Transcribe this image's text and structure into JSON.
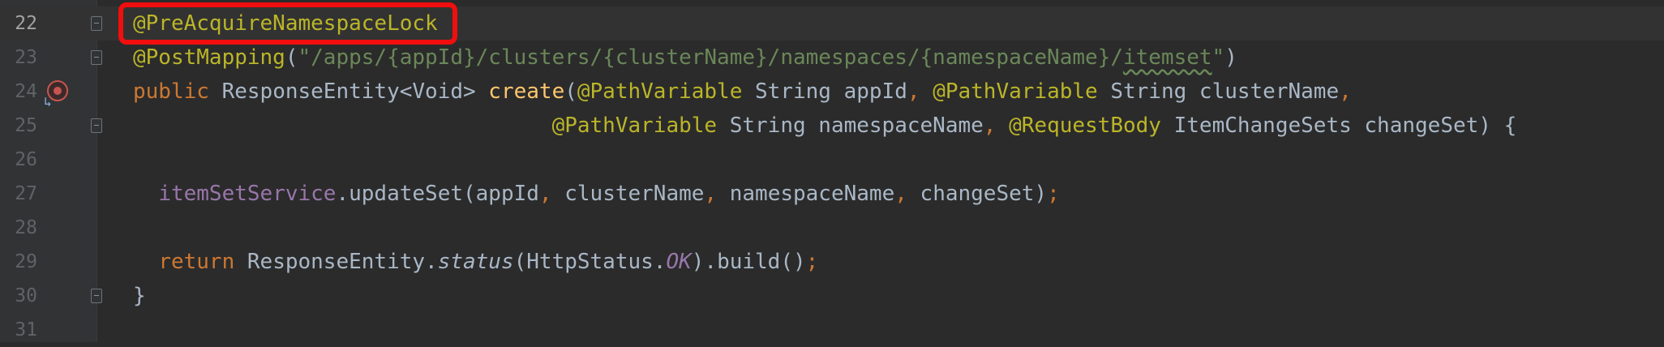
{
  "editor": {
    "line_numbers": [
      "22",
      "23",
      "24",
      "25",
      "26",
      "27",
      "28",
      "29",
      "30",
      "31"
    ],
    "lines": {
      "l22": {
        "annotation": "@PreAcquireNamespaceLock"
      },
      "l23": {
        "annotation": "@PostMapping",
        "open": "(",
        "str_a": "\"/apps/{appId}/clusters/{clusterName}/namespaces/{namespaceName}/",
        "str_b": "itemset",
        "str_c": "\"",
        "close": ")"
      },
      "l24": {
        "kw": "public",
        "type": " ResponseEntity<Void> ",
        "fn": "create",
        "open": "(",
        "ann1": "@PathVariable",
        "p1": " String appId",
        "comma1": ",",
        "sp1": " ",
        "ann2": "@PathVariable",
        "p2": " String clusterName",
        "comma2": ","
      },
      "l25": {
        "indent": "                                 ",
        "ann1": "@PathVariable",
        "p1": " String namespaceName",
        "comma1": ",",
        "sp1": " ",
        "ann2": "@RequestBody",
        "p2": " ItemChangeSets changeSet) {"
      },
      "l27": {
        "indent": "  ",
        "field": "itemSetService",
        "call": ".updateSet(appId",
        "c1": ",",
        "a2": " clusterName",
        "c2": ",",
        "a3": " namespaceName",
        "c3": ",",
        "a4": " changeSet)",
        "semi": ";"
      },
      "l29": {
        "indent": "  ",
        "kw": "return",
        "cls": " ResponseEntity.",
        "method": "status",
        "arg_open": "(HttpStatus.",
        "const": "OK",
        "rest": ").build()",
        "semi": ";"
      },
      "l30": {
        "brace": "}"
      }
    }
  },
  "colors": {
    "background": "#2b2b2b",
    "annotation": "#bbb529",
    "string": "#6a8759",
    "keyword": "#cc7832",
    "function": "#ffc66d",
    "field": "#9876aa",
    "highlight_box": "#f10e0e"
  },
  "gutter_icons": [
    "fold-icon",
    "breakpoint-override-icon",
    "navigate-arrow-icon"
  ]
}
